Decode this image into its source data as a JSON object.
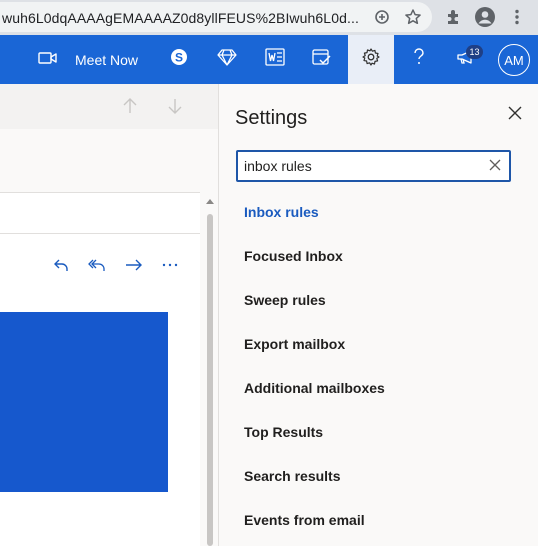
{
  "browser": {
    "url": "wuh6L0dqAAAAgEMAAAAZ0d8yllFEUS%2BIwuh6L0d...",
    "icons": [
      "add-circle-icon",
      "star-icon",
      "extensions-icon",
      "profile-icon",
      "kebab-menu-icon"
    ]
  },
  "header": {
    "meet_now_label": "Meet Now",
    "notification_count": "13",
    "avatar_initials": "AM",
    "accent": "#1a66d6"
  },
  "settings": {
    "title": "Settings",
    "search_value": "inbox rules",
    "results": [
      {
        "label": "Inbox rules",
        "active": true
      },
      {
        "label": "Focused Inbox",
        "active": false
      },
      {
        "label": "Sweep rules",
        "active": false
      },
      {
        "label": "Export mailbox",
        "active": false
      },
      {
        "label": "Additional mailboxes",
        "active": false
      },
      {
        "label": "Top Results",
        "active": false
      },
      {
        "label": "Search results",
        "active": false
      },
      {
        "label": "Events from email",
        "active": false
      }
    ]
  }
}
